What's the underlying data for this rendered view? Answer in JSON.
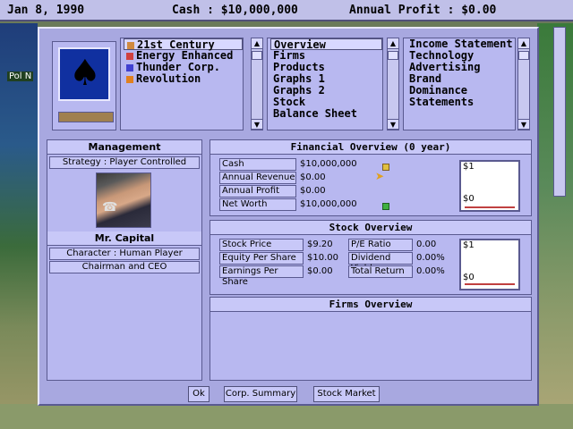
{
  "topbar": {
    "date": "Jan 8, 1990",
    "cash": "Cash : $10,000,000",
    "profit": "Annual Profit : $0.00"
  },
  "bg": {
    "left_label": "Pol N"
  },
  "corporations": [
    {
      "name": "21st Century",
      "color": "#d08a40",
      "selected": true
    },
    {
      "name": "Energy Enhanced",
      "color": "#d04040"
    },
    {
      "name": "Thunder Corp.",
      "color": "#4040d0"
    },
    {
      "name": "Revolution",
      "color": "#e08020"
    }
  ],
  "views": [
    "Overview",
    "Firms",
    "Products",
    "Graphs 1",
    "Graphs 2",
    "Stock",
    "Balance Sheet"
  ],
  "reports": [
    "Income Statement",
    "Technology",
    "Advertising",
    "Brand",
    "Dominance",
    "Statements"
  ],
  "management": {
    "title": "Management",
    "strategy": "Strategy : Player Controlled",
    "name": "Mr. Capital",
    "character": "Character : Human Player",
    "position": "Chairman and CEO"
  },
  "financial": {
    "title": "Financial Overview (0 year)",
    "rows": [
      {
        "label": "Cash",
        "value": "$10,000,000"
      },
      {
        "label": "Annual Revenue",
        "value": "$0.00"
      },
      {
        "label": "Annual Profit",
        "value": "$0.00"
      },
      {
        "label": "Net Worth",
        "value": "$10,000,000"
      }
    ],
    "graph": {
      "top": "$1",
      "bottom": "$0"
    }
  },
  "stock": {
    "title": "Stock Overview",
    "left": [
      {
        "label": "Stock Price",
        "value": "$9.20"
      },
      {
        "label": "Equity Per Share",
        "value": "$10.00"
      },
      {
        "label": "Earnings Per Share",
        "value": "$0.00"
      }
    ],
    "right": [
      {
        "label": "P/E Ratio",
        "value": "0.00"
      },
      {
        "label": "Dividend Yield",
        "value": "0.00%"
      },
      {
        "label": "Total Return",
        "value": "0.00%"
      }
    ],
    "graph": {
      "top": "$1",
      "bottom": "$0"
    }
  },
  "firms": {
    "title": "Firms Overview"
  },
  "buttons": {
    "ok": "Ok",
    "corp_summary": "Corp. Summary",
    "stock_market": "Stock Market"
  },
  "colors": {
    "window": "#a8a8e0",
    "panel": "#b8b8f0",
    "accent": "#5a5a90"
  }
}
